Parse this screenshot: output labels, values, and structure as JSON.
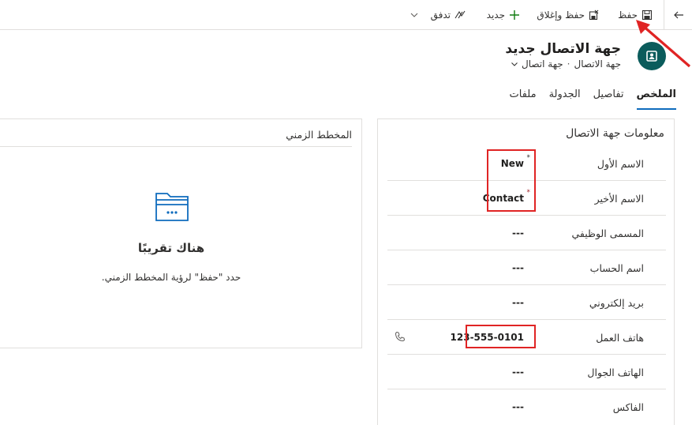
{
  "command_bar": {
    "save_label": "حفظ",
    "save_close_label": "حفظ وإغلاق",
    "new_label": "جديد",
    "flow_label": "تدفق",
    "icons": [
      "back-arrow-icon",
      "save-icon",
      "save-close-icon",
      "plus-icon",
      "flow-icon",
      "chevron-down-icon"
    ]
  },
  "header": {
    "title": "جهة الاتصال جديد",
    "entity_type": "جهة الاتصال",
    "separator": "·",
    "form_name": "جهة اتصال",
    "avatar_color": "#0b5c5c"
  },
  "tabs": [
    {
      "label": "الملخص",
      "active": true
    },
    {
      "label": "تفاصيل",
      "active": false
    },
    {
      "label": "الجدولة",
      "active": false
    },
    {
      "label": "ملفات",
      "active": false
    }
  ],
  "contact_info": {
    "title": "معلومات جهة الاتصال",
    "fields": [
      {
        "label": "الاسم الأول",
        "value": "New",
        "required_mark": "*",
        "highlighted": true
      },
      {
        "label": "الاسم الأخير",
        "value": "Contact",
        "required_mark": "*",
        "highlighted": true
      },
      {
        "label": "المسمى الوظيفي",
        "value": "---"
      },
      {
        "label": "اسم الحساب",
        "value": "---"
      },
      {
        "label": "بريد إلكتروني",
        "value": "---"
      },
      {
        "label": "هاتف العمل",
        "value": "123-555-0101",
        "highlighted": true
      },
      {
        "label": "الهاتف الجوال",
        "value": "---"
      },
      {
        "label": "الفاكس",
        "value": "---"
      }
    ]
  },
  "timeline": {
    "title": "المخطط الزمني",
    "empty_title": "هناك تقريبًا",
    "empty_hint": "حدد \"حفظ\" لرؤية المخطط الزمني."
  },
  "colors": {
    "accent": "#0f6cbd",
    "annotation_red": "#e02424",
    "required_red": "#a4262c",
    "new_plus_green": "#107c10"
  }
}
